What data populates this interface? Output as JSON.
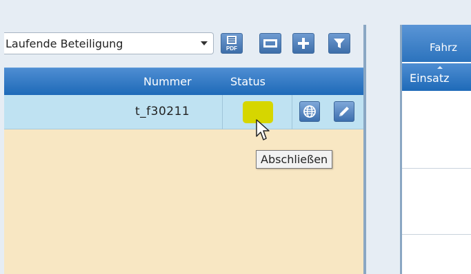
{
  "left": {
    "filter_select": {
      "value": "Laufende Beteiligung"
    },
    "toolbar": {
      "pdf_icon": "pdf-export-icon",
      "minimize_icon": "minimize-icon",
      "add_icon": "plus-icon",
      "filter_icon": "funnel-filter-icon",
      "pdf_icon_text": "PDF"
    },
    "columns": {
      "number": "Nummer",
      "status": "Status"
    },
    "row": {
      "number": "t_f30211",
      "status_color": "#d6d600",
      "globe_icon": "globe-icon",
      "edit_icon": "pencil-edit-icon"
    },
    "tooltip": "Abschließen"
  },
  "right": {
    "tab_label": "Fahrz",
    "column_label": "Einsatz"
  },
  "colors": {
    "header_blue": "#1e6ab8",
    "row_selected": "#bfe2f2",
    "panel_bg": "#f8e7c3",
    "app_bg": "#e6edf4"
  }
}
